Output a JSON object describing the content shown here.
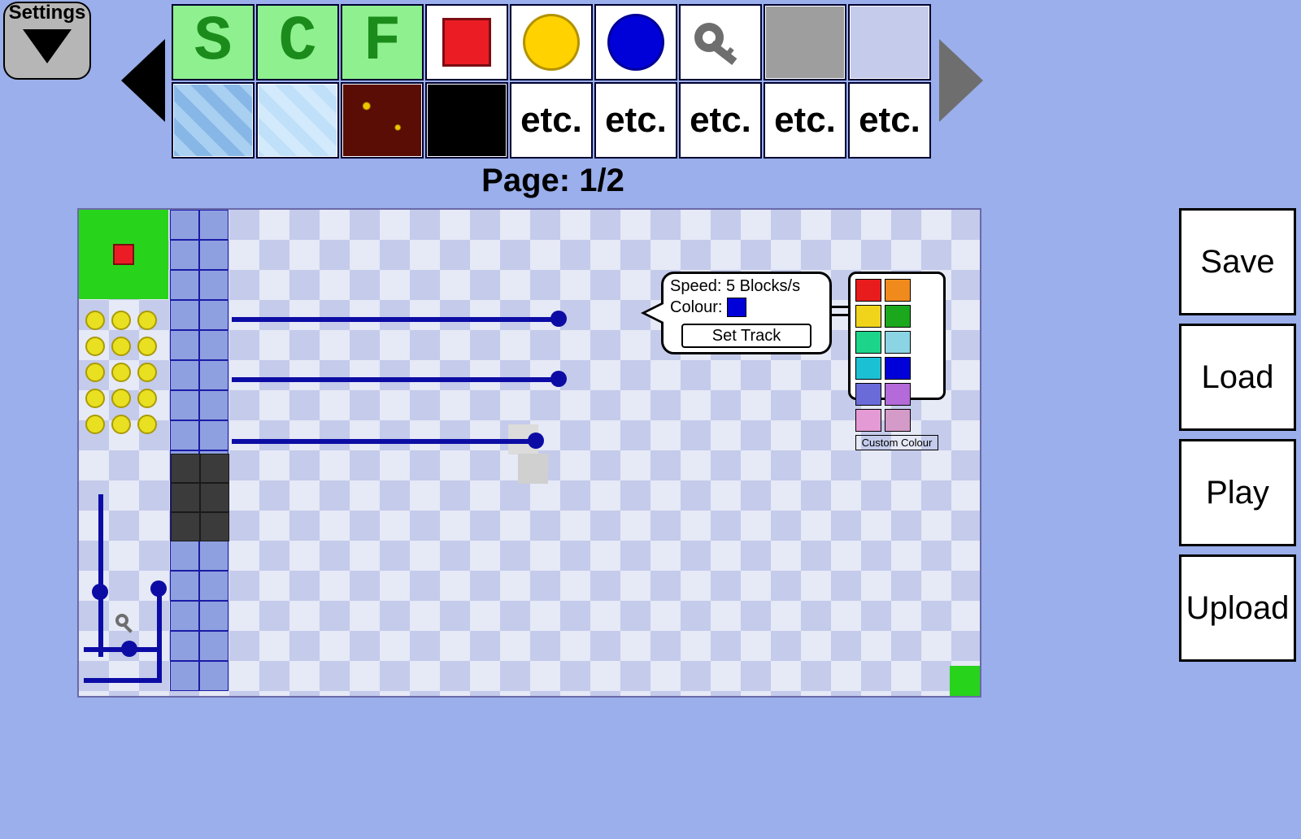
{
  "settings": {
    "label": "Settings"
  },
  "palette": {
    "page_label": "Page: 1/2",
    "row1": [
      {
        "kind": "letter",
        "text": "S"
      },
      {
        "kind": "letter",
        "text": "C"
      },
      {
        "kind": "letter",
        "text": "F"
      },
      {
        "kind": "swatch",
        "name": "red-square",
        "fill": "#ec1c24",
        "shape": "square"
      },
      {
        "kind": "swatch",
        "name": "yellow-circle",
        "fill": "#ffd200",
        "shape": "circle"
      },
      {
        "kind": "swatch",
        "name": "blue-circle",
        "fill": "#0000d8",
        "shape": "circle"
      },
      {
        "kind": "key-icon"
      },
      {
        "kind": "swatch",
        "name": "gray-square",
        "fill": "#9e9e9e",
        "shape": "square-full"
      },
      {
        "kind": "swatch",
        "name": "lavender-square",
        "fill": "#c4cbeb",
        "shape": "square-full"
      }
    ],
    "row2": [
      {
        "kind": "texture",
        "name": "ice-blue",
        "fill1": "#a9cff1",
        "fill2": "#87b7e6"
      },
      {
        "kind": "texture",
        "name": "light-ice",
        "fill1": "#d3eafc",
        "fill2": "#bfe0f8"
      },
      {
        "kind": "texture",
        "name": "lava",
        "fill1": "#5a0d04",
        "fill2": "#e9c800"
      },
      {
        "kind": "swatch",
        "name": "black-square",
        "fill": "#000000",
        "shape": "square-full"
      },
      {
        "kind": "etc",
        "text": "etc."
      },
      {
        "kind": "etc",
        "text": "etc."
      },
      {
        "kind": "etc",
        "text": "etc."
      },
      {
        "kind": "etc",
        "text": "etc."
      },
      {
        "kind": "etc",
        "text": "etc."
      }
    ]
  },
  "side_buttons": [
    "Save",
    "Load",
    "Play",
    "Upload"
  ],
  "popup": {
    "speed_label": "Speed: 5 Blocks/s",
    "colour_label": "Colour:",
    "colour_value": "#0000d8",
    "button": "Set Track"
  },
  "color_picker": {
    "colors": [
      "#e81c1c",
      "#f08a1c",
      "#f0d41c",
      "#1ca81c",
      "#1cd48a",
      "#8ad4e4",
      "#1cc0d4",
      "#0000d8",
      "#6a6ad8",
      "#b46ad8",
      "#e49ad4",
      "#d49ac8"
    ],
    "custom_label": "Custom Colour"
  }
}
